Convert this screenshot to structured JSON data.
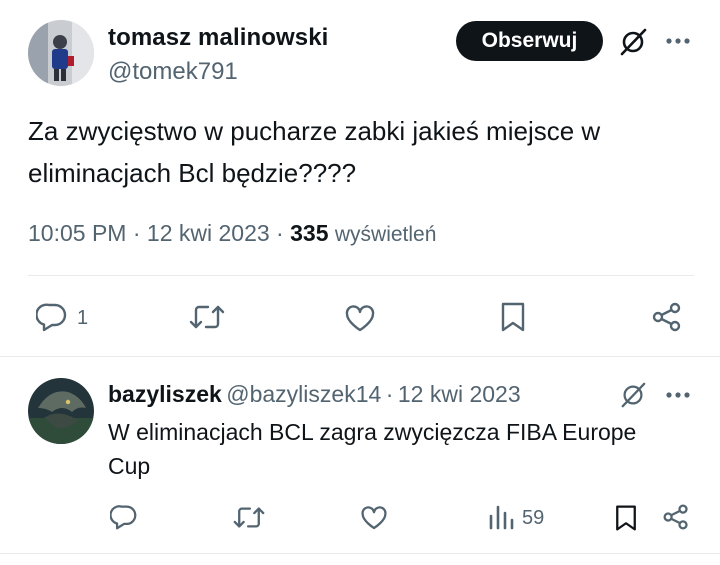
{
  "tweet": {
    "author_name": "tomasz malinowski",
    "author_handle": "@tomek791",
    "follow_label": "Obserwuj",
    "text": "Za zwycięstwo w pucharze zabki jakieś miejsce w eliminacjach Bcl będzie????",
    "time": "10:05 PM",
    "date": "12 kwi 2023",
    "views_count": "335",
    "views_label": "wyświetleń",
    "reply_count": "1"
  },
  "reply": {
    "author_name": "bazyliszek",
    "author_handle": "@bazyliszek14",
    "date": "12 kwi 2023",
    "text": "W eliminacjach BCL zagra zwycięzcza FIBA Europe Cup",
    "views_count": "59"
  },
  "separator": "·",
  "icons": {
    "grok": "grok-icon",
    "more": "more-icon",
    "reply": "reply-icon",
    "retweet": "retweet-icon",
    "like": "like-icon",
    "bookmark": "bookmark-icon",
    "share": "share-icon",
    "views": "views-icon"
  },
  "colors": {
    "text": "#0f1419",
    "secondary": "#536471",
    "divider": "#e7e9ea",
    "button": "#0f1419"
  }
}
